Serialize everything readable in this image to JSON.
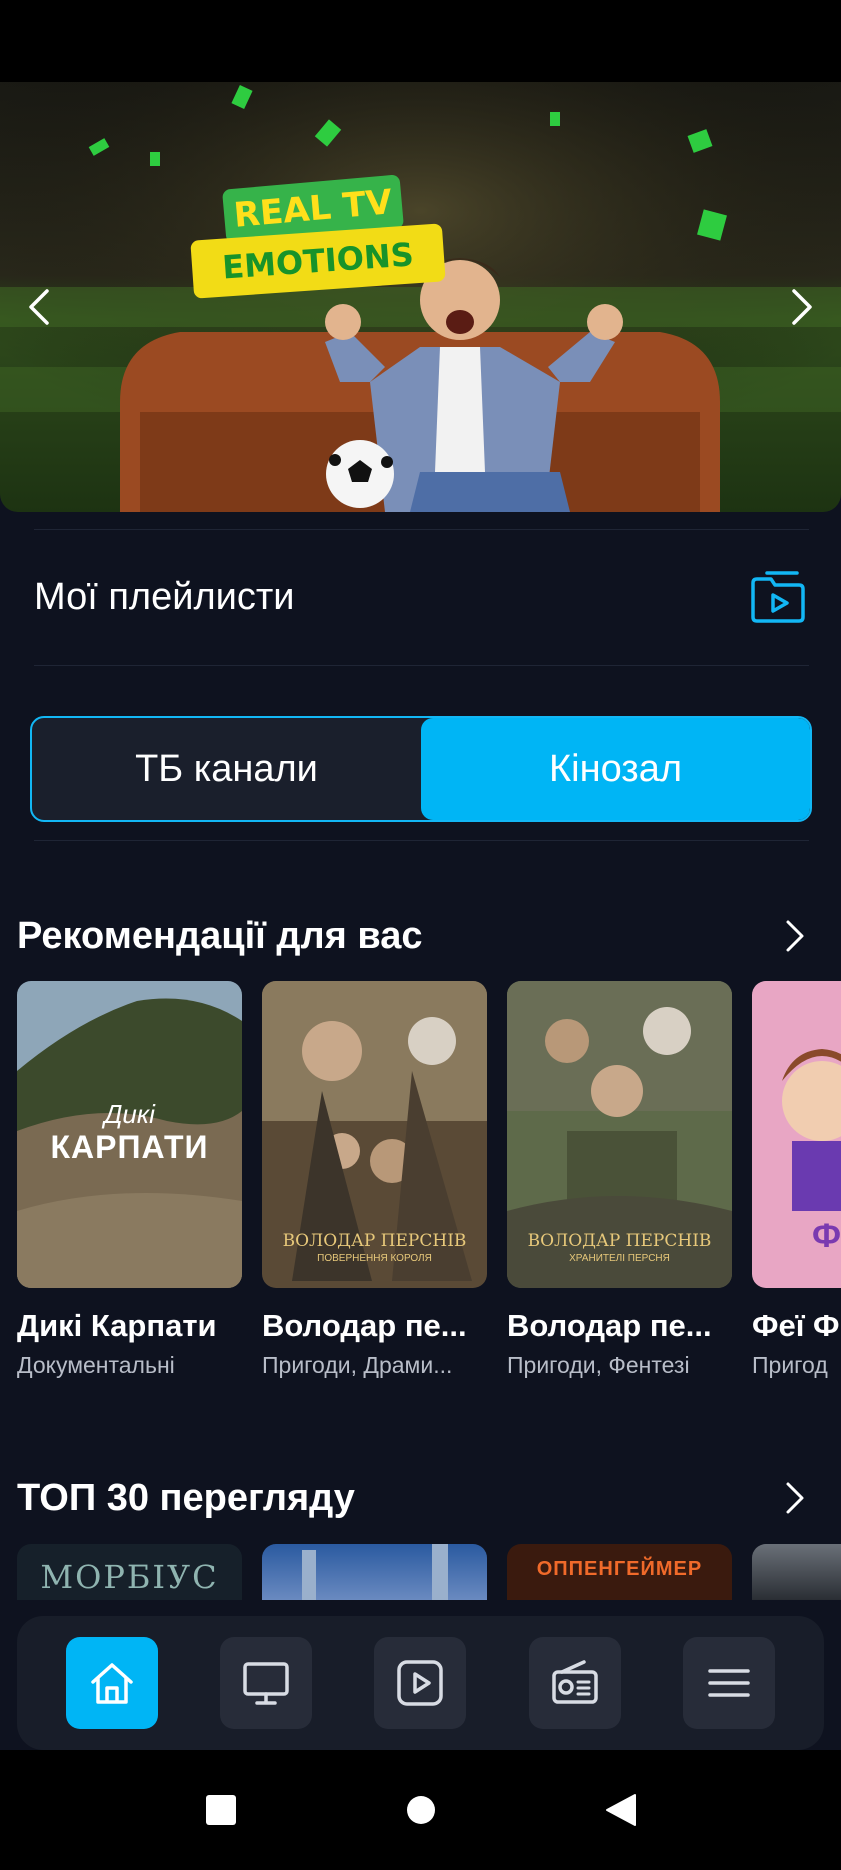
{
  "banner": {
    "badge_line1": "REAL TV",
    "badge_line2": "EMOTIONS",
    "prev_icon": "chevron-left-icon",
    "next_icon": "chevron-right-icon"
  },
  "playlists": {
    "title": "Мої плейлисти",
    "icon": "playlist-folder-icon"
  },
  "tabs": {
    "items": [
      {
        "label": "ТБ канали",
        "active": false
      },
      {
        "label": "Кінозал",
        "active": true
      }
    ]
  },
  "recommendations": {
    "title": "Рекомендації для вас",
    "items": [
      {
        "title": "Дикі Карпати",
        "subtitle": "Документальні",
        "poster_line1": "Дикі",
        "poster_line2": "КАРПАТИ"
      },
      {
        "title": "Володар пе...",
        "subtitle": "Пригоди, Драми...",
        "poster_line1": "ВОЛОДАР ПЕРСНІВ",
        "poster_line2": "ПОВЕРНЕННЯ КОРОЛЯ"
      },
      {
        "title": "Володар пе...",
        "subtitle": "Пригоди, Фентезі",
        "poster_line1": "ВОЛОДАР ПЕРСНІВ",
        "poster_line2": "ХРАНИТЕЛІ ПЕРСНЯ"
      },
      {
        "title": "Феї Ф",
        "subtitle": "Пригод",
        "poster_line1": "ФЕ",
        "poster_line2": ""
      }
    ]
  },
  "top30": {
    "title": "ТОП 30 перегляду",
    "items": [
      {
        "poster_text": "МОРБІУС"
      },
      {
        "poster_text": ""
      },
      {
        "poster_text": "ОППЕНГЕЙМЕР"
      },
      {
        "poster_text": ""
      }
    ]
  },
  "bottom_nav": {
    "items": [
      {
        "icon": "home-icon",
        "active": true
      },
      {
        "icon": "tv-monitor-icon",
        "active": false
      },
      {
        "icon": "play-icon",
        "active": false
      },
      {
        "icon": "radio-icon",
        "active": false
      },
      {
        "icon": "menu-icon",
        "active": false
      }
    ]
  },
  "system_nav": {
    "items": [
      "recents-square-icon",
      "home-circle-icon",
      "back-triangle-icon"
    ]
  },
  "colors": {
    "accent": "#00b5f5",
    "background": "#0e121f",
    "surface": "#181d29"
  }
}
